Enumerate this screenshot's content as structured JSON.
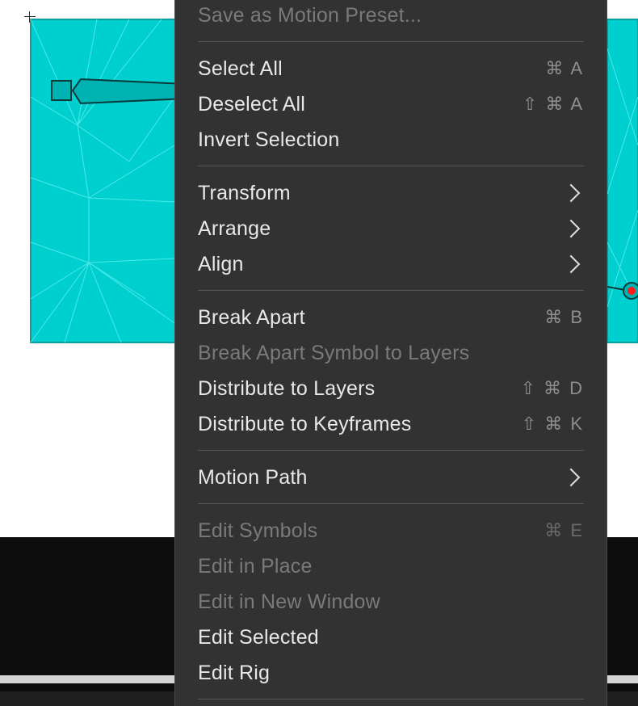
{
  "menu": {
    "items": [
      {
        "label": "Save as Motion Preset...",
        "shortcut": "",
        "disabled": true
      },
      {
        "label": "Select All",
        "shortcut": "⌘ A",
        "disabled": false
      },
      {
        "label": "Deselect All",
        "shortcut": "⇧ ⌘ A",
        "disabled": false
      },
      {
        "label": "Invert Selection",
        "shortcut": "",
        "disabled": false
      },
      {
        "label": "Transform",
        "shortcut": "",
        "submenu": true,
        "disabled": false
      },
      {
        "label": "Arrange",
        "shortcut": "",
        "submenu": true,
        "disabled": false
      },
      {
        "label": "Align",
        "shortcut": "",
        "submenu": true,
        "disabled": false
      },
      {
        "label": "Break Apart",
        "shortcut": "⌘ B",
        "disabled": false
      },
      {
        "label": "Break Apart Symbol to Layers",
        "shortcut": "",
        "disabled": true
      },
      {
        "label": "Distribute to Layers",
        "shortcut": "⇧ ⌘ D",
        "disabled": false
      },
      {
        "label": "Distribute to Keyframes",
        "shortcut": "⇧ ⌘ K",
        "disabled": false
      },
      {
        "label": "Motion Path",
        "shortcut": "",
        "submenu": true,
        "disabled": false
      },
      {
        "label": "Edit Symbols",
        "shortcut": "⌘ E",
        "disabled": true
      },
      {
        "label": "Edit in Place",
        "shortcut": "",
        "disabled": true
      },
      {
        "label": "Edit in New Window",
        "shortcut": "",
        "disabled": true
      },
      {
        "label": "Edit Selected",
        "shortcut": "",
        "disabled": false
      },
      {
        "label": "Edit Rig",
        "shortcut": "",
        "disabled": false
      }
    ]
  },
  "icons": {
    "submenu": "chevron-right-icon",
    "crosshair": "crosshair-icon",
    "bone": "bone-icon",
    "joint": "joint-icon"
  },
  "colors": {
    "shape_fill": "#00cfcf",
    "mesh_line": "#4de8e8",
    "menu_bg": "#323232",
    "joint_red": "#ff1a1a"
  }
}
